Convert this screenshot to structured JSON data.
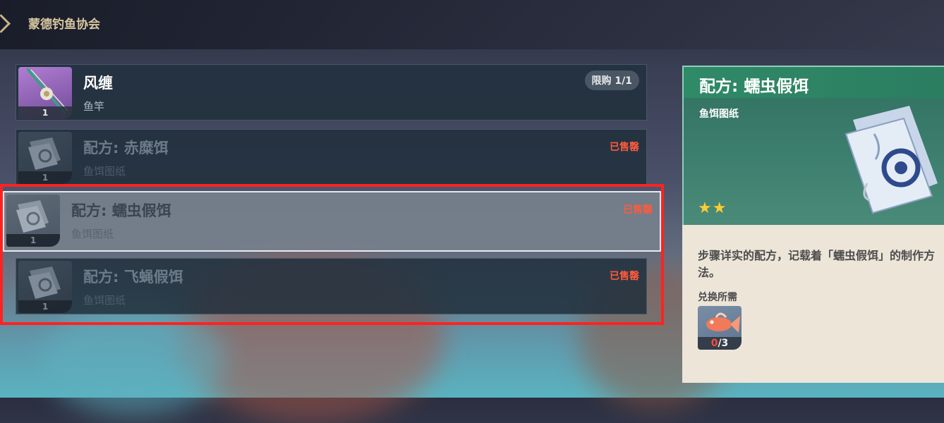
{
  "header": {
    "title": "蒙德钓鱼协会"
  },
  "shop_items": [
    {
      "name": "风缠",
      "type": "鱼竿",
      "quantity": "1",
      "badge": "限购 1/1",
      "icon": "fishing-rod-icon"
    },
    {
      "name": "配方: 赤糜饵",
      "type": "鱼饵图纸",
      "quantity": "1",
      "status": "已售罄",
      "icon": "bait-scroll-icon"
    },
    {
      "name": "配方: 蠕虫假饵",
      "type": "鱼饵图纸",
      "quantity": "1",
      "status": "已售罄",
      "icon": "bait-scroll-icon"
    },
    {
      "name": "配方: 飞蝇假饵",
      "type": "鱼饵图纸",
      "quantity": "1",
      "status": "已售罄",
      "icon": "bait-scroll-icon"
    }
  ],
  "detail": {
    "title": "配方: 蠕虫假饵",
    "category": "鱼饵图纸",
    "stars": "★★",
    "rarity": 2,
    "description": "步骤详实的配方，记载着「蠕虫假饵」的制作方法。",
    "cost_label": "兑换所需",
    "cost": {
      "have": "0",
      "need": "/3",
      "icon": "fish-icon"
    }
  },
  "colors": {
    "sold_out": "#ff5a3c",
    "highlight": "#ff2222",
    "star": "#ffcc33"
  }
}
